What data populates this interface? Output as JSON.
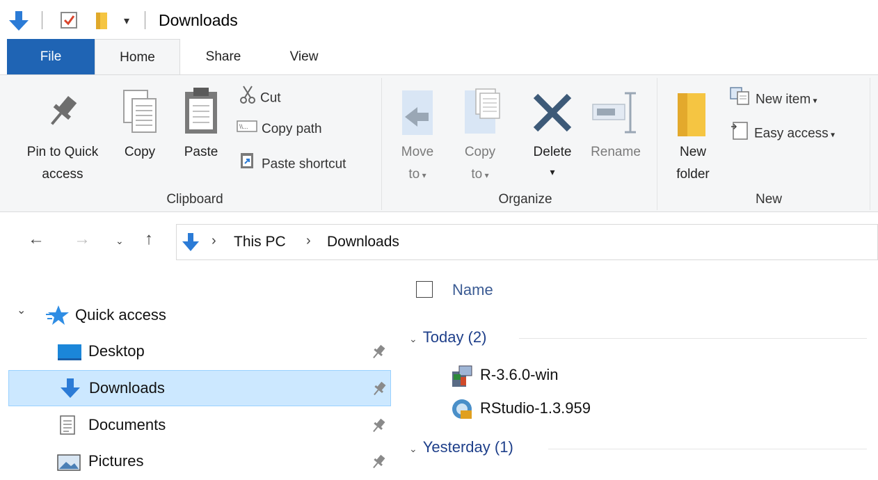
{
  "window": {
    "title": "Downloads"
  },
  "tabs": {
    "file": "File",
    "home": "Home",
    "share": "Share",
    "view": "View"
  },
  "ribbon": {
    "clipboard": {
      "label": "Clipboard",
      "pin_line1": "Pin to Quick",
      "pin_line2": "access",
      "copy": "Copy",
      "paste": "Paste",
      "cut": "Cut",
      "copy_path": "Copy path",
      "paste_shortcut": "Paste shortcut"
    },
    "organize": {
      "label": "Organize",
      "move_line1": "Move",
      "move_line2": "to",
      "copy_line1": "Copy",
      "copy_line2": "to",
      "delete": "Delete",
      "rename": "Rename"
    },
    "new": {
      "label": "New",
      "folder_line1": "New",
      "folder_line2": "folder",
      "new_item": "New item",
      "easy_access": "Easy access"
    }
  },
  "address": {
    "crumbs": [
      "This PC",
      "Downloads"
    ]
  },
  "navpane": {
    "quick_access": "Quick access",
    "items": [
      {
        "label": "Desktop",
        "icon": "desktop-icon"
      },
      {
        "label": "Downloads",
        "icon": "downloads-icon",
        "selected": true
      },
      {
        "label": "Documents",
        "icon": "documents-icon"
      },
      {
        "label": "Pictures",
        "icon": "pictures-icon"
      }
    ]
  },
  "content": {
    "column_name": "Name",
    "groups": [
      {
        "header": "Today (2)",
        "files": [
          "R-3.6.0-win",
          "RStudio-1.3.959"
        ]
      },
      {
        "header": "Yesterday (1)",
        "files": []
      }
    ]
  },
  "colors": {
    "file_tab": "#1f64b4",
    "selection": "#cce8ff",
    "group_header": "#1e3f8a"
  }
}
